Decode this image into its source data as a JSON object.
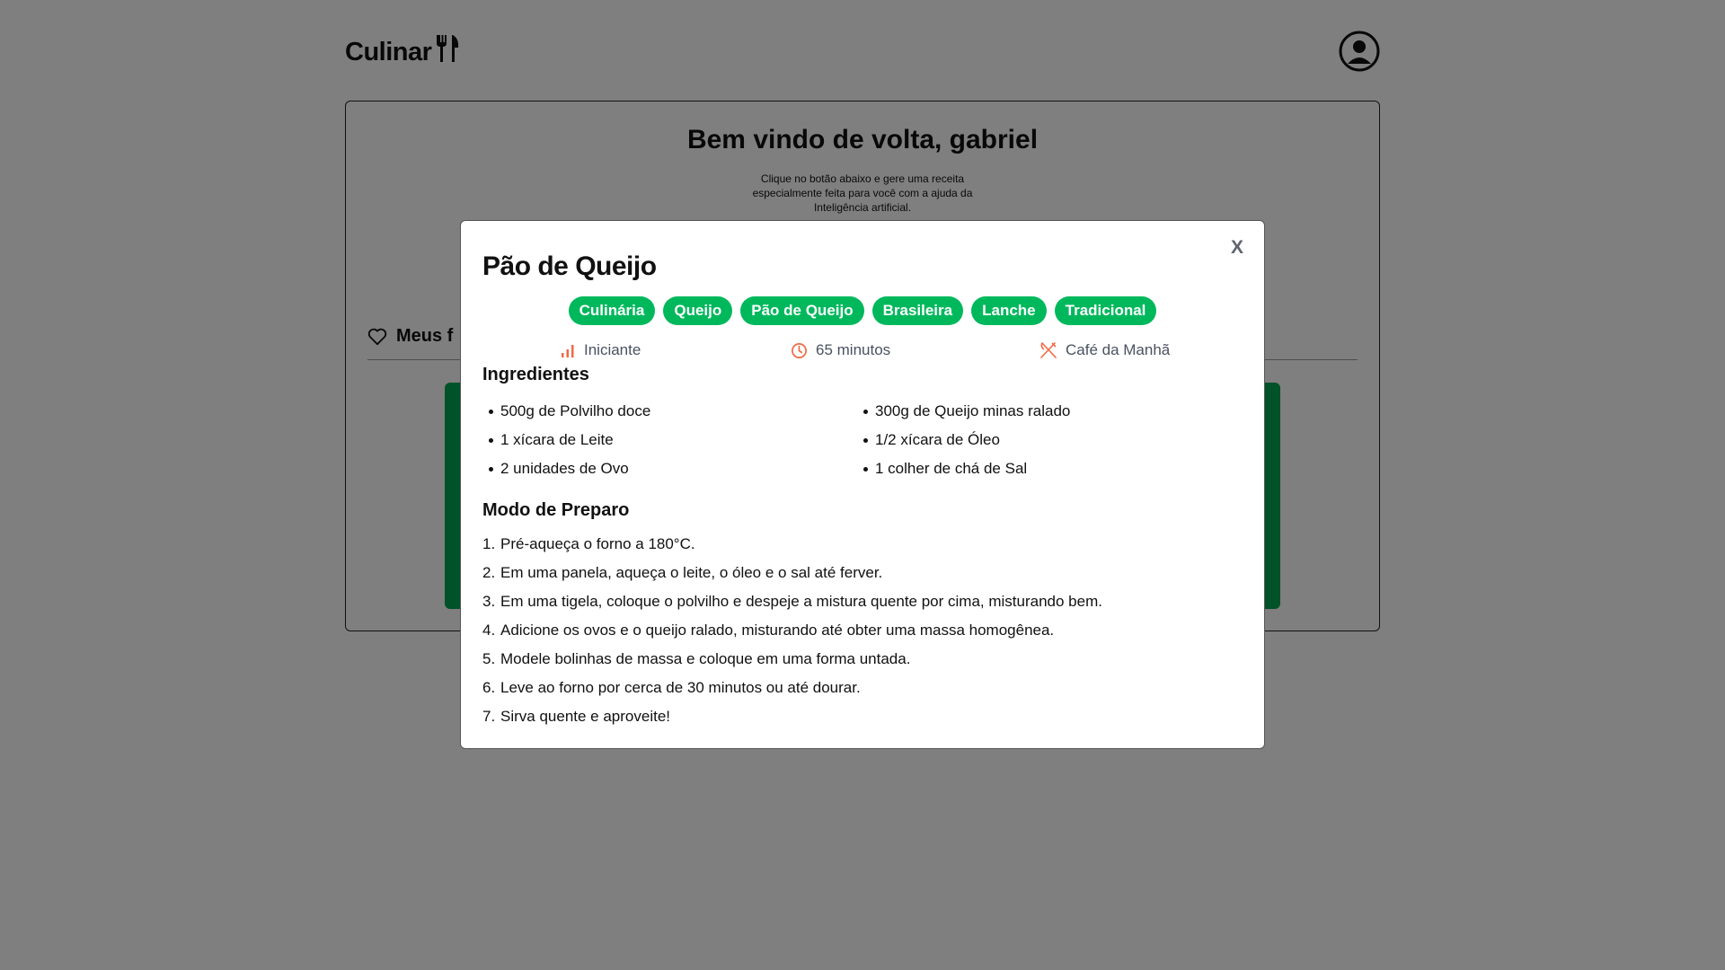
{
  "app": {
    "logo_text": "Culinar"
  },
  "main": {
    "welcome_title": "Bem vindo de volta, gabriel",
    "welcome_subtitle": "Clique no botão abaixo e gere uma receita especialmente feita para você com a ajuda da Inteligência artificial.",
    "favorites_tab_label": "Meus f"
  },
  "modal": {
    "close_label": "X",
    "title": "Pão de Queijo",
    "tags": [
      "Culinária",
      "Queijo",
      "Pão de Queijo",
      "Brasileira",
      "Lanche",
      "Tradicional"
    ],
    "difficulty": "Iniciante",
    "time": "65 minutos",
    "meal_type": "Café da Manhã",
    "ingredients_title": "Ingredientes",
    "ingredients": [
      "500g de Polvilho doce",
      "300g de Queijo minas ralado",
      "1 xícara de Leite",
      "1/2 xícara de Óleo",
      "2 unidades de Ovo",
      "1 colher de chá de Sal"
    ],
    "steps_title": "Modo de Preparo",
    "steps": [
      "Pré-aqueça o forno a 180°C.",
      "Em uma panela, aqueça o leite, o óleo e o sal até ferver.",
      "Em uma tigela, coloque o polvilho e despeje a mistura quente por cima, misturando bem.",
      "Adicione os ovos e o queijo ralado, misturando até obter uma massa homogênea.",
      "Modele bolinhas de massa e coloque em uma forma untada.",
      "Leve ao forno por cerca de 30 minutos ou até dourar.",
      "Sirva quente e aproveite!"
    ]
  },
  "colors": {
    "accent_green": "#00b85c",
    "meta_icon_orange": "#f06a45",
    "overlay": "rgba(0,0,0,0.5)"
  },
  "icons": {
    "logo": "fork-spoon-icon",
    "profile": "user-circle-icon",
    "favorites": "heart-icon",
    "difficulty": "signal-bars-icon",
    "time": "clock-icon",
    "meal": "utensils-crossed-icon"
  }
}
